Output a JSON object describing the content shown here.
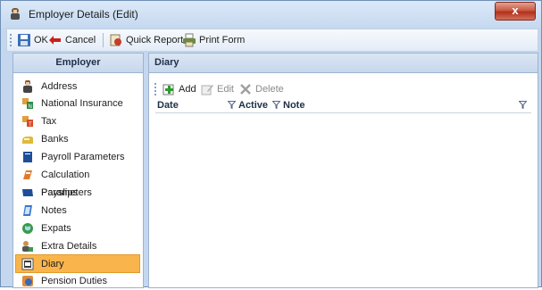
{
  "window": {
    "title": "Employer Details (Edit)",
    "close_glyph": "x"
  },
  "toolbar": {
    "ok_label": "OK",
    "cancel_label": "Cancel",
    "quick_report_label": "Quick Report",
    "print_form_label": "Print Form"
  },
  "left_panel": {
    "header": "Employer",
    "items": [
      {
        "label": "Address",
        "icon": "address-icon"
      },
      {
        "label": "National Insurance",
        "icon": "national-insurance-icon"
      },
      {
        "label": "Tax",
        "icon": "tax-icon"
      },
      {
        "label": "Banks",
        "icon": "banks-icon"
      },
      {
        "label": "Payroll Parameters",
        "icon": "payroll-parameters-icon"
      },
      {
        "label": "Calculation Parameters",
        "icon": "calculation-parameters-icon"
      },
      {
        "label": "Payslips",
        "icon": "payslips-icon"
      },
      {
        "label": "Notes",
        "icon": "notes-icon"
      },
      {
        "label": "Expats",
        "icon": "expats-icon"
      },
      {
        "label": "Extra Details",
        "icon": "extra-details-icon"
      },
      {
        "label": "Diary",
        "icon": "diary-icon",
        "selected": true
      },
      {
        "label": "Pension Duties",
        "icon": "pension-duties-icon"
      }
    ]
  },
  "right_panel": {
    "header": "Diary",
    "toolbar": {
      "add_label": "Add",
      "edit_label": "Edit",
      "delete_label": "Delete"
    },
    "columns": [
      "Date",
      "Active",
      "Note"
    ],
    "rows": []
  },
  "colors": {
    "selected_bg": "#f9b54c",
    "panel_header": "#c7d7ec",
    "window_bg": "#c4d7ee"
  }
}
